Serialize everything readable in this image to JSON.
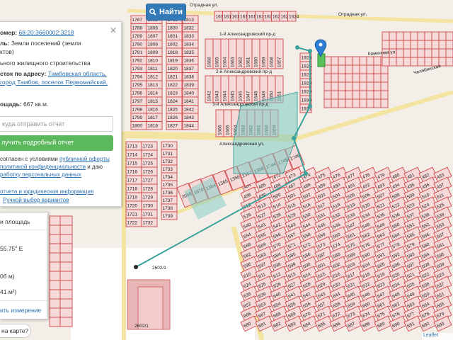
{
  "search": {
    "button_label": "Найти",
    "icon": "search-icon"
  },
  "info": {
    "cadastral_label": "омер:",
    "cadastral_value": "68:20:3660002:3218",
    "category_label": "ль:",
    "category_value": "Земли поселений (земли",
    "category_cont": "ктов)",
    "use_value": "ьного жилищного строительства",
    "address_label": "сток по адресу:",
    "address_line1": "Тамбовская область,",
    "address_line2": "город Тамбов, поселок Первомайский,",
    "area_label": "ощадь:",
    "area_value": "667 кв.м.",
    "email_placeholder": "куда отправить отчет",
    "report_button": "лучить подробный отчет",
    "consent_line1_a": "согласен с условиями ",
    "consent_line1_link": "публичной оферты",
    "consent_line2_link": "политикой конфиденциальности",
    "consent_line2_b": " и даю",
    "consent_line3_link": "работку персональных данных",
    "links_line1": "отчета и юридическая информация",
    "links_line2": "Ручной выбор вариантов"
  },
  "measure": {
    "title": "и площадь",
    "coord": "55.75\" E",
    "length": "06 м)",
    "area": "41 м²)",
    "clear": "ить измерение"
  },
  "bubble_text": "на карте?",
  "attribution": "Leaflet",
  "map": {
    "streets": [
      "Отрадная ул.",
      "Каменная ул.",
      "Челябинская",
      "1-й Александровский пр-д",
      "2-й Александровский пр-д",
      "3-й Александровский пр-д",
      "Александровская ул."
    ],
    "parcel_numbers": {
      "col1": [
        "1787",
        "1788",
        "1789",
        "1790",
        "1791",
        "1792",
        "1793",
        "1794",
        "1795",
        "1796",
        "1797",
        "1798",
        "1799",
        "1800"
      ],
      "col2": [
        "1803",
        "1806",
        "1807",
        "1808",
        "1809",
        "1810",
        "1811",
        "1812",
        "1813",
        "1814",
        "1815",
        "1816",
        "1817",
        "1818"
      ],
      "col3": [
        "1799",
        "1800",
        "1801",
        "1802",
        "1818",
        "1819",
        "1820",
        "1821",
        "1822",
        "1823",
        "1824",
        "1825",
        "1826",
        "1827"
      ],
      "col4": [
        "1813",
        "1832",
        "1833",
        "1834",
        "1835",
        "1836",
        "1837",
        "1838",
        "1839",
        "1840",
        "1841",
        "1842",
        "1843",
        "1844"
      ],
      "top_row": [
        "1615",
        "1616",
        "1617",
        "1618",
        "1619",
        "1620",
        "1621",
        "1622",
        "1623",
        "1624"
      ],
      "row2": [
        "1666",
        "1665",
        "1664",
        "1663",
        "1662",
        "1661",
        "1660",
        "1659",
        "1658",
        "1657"
      ],
      "row3": [
        "1642",
        "1643",
        "1644",
        "1645",
        "1646",
        "1647",
        "1648",
        "1649",
        "1650",
        "1651"
      ],
      "right_col": [
        "1925",
        "1926",
        "1927",
        "1928",
        "1929",
        "1930",
        "1931"
      ],
      "left_lower": [
        "1713",
        "1714",
        "1715",
        "1716",
        "1717",
        "1718",
        "1719",
        "1720",
        "1721",
        "1722"
      ],
      "left_lower2": [
        "1723",
        "1724",
        "1725",
        "1726",
        "1727",
        "1728",
        "1729",
        "1730",
        "1731",
        "1732"
      ],
      "mid_lower": [
        "1730",
        "1731",
        "1732",
        "1733",
        "1734",
        "1735",
        "1736",
        "1737",
        "1738",
        "1739"
      ],
      "big_parcels": [
        "2602/1",
        "2602/1"
      ],
      "misc": [
        "2058",
        "1670",
        "1364",
        "1365",
        "1356",
        "1357",
        "1358",
        "1744",
        "1746",
        "1748"
      ]
    }
  }
}
